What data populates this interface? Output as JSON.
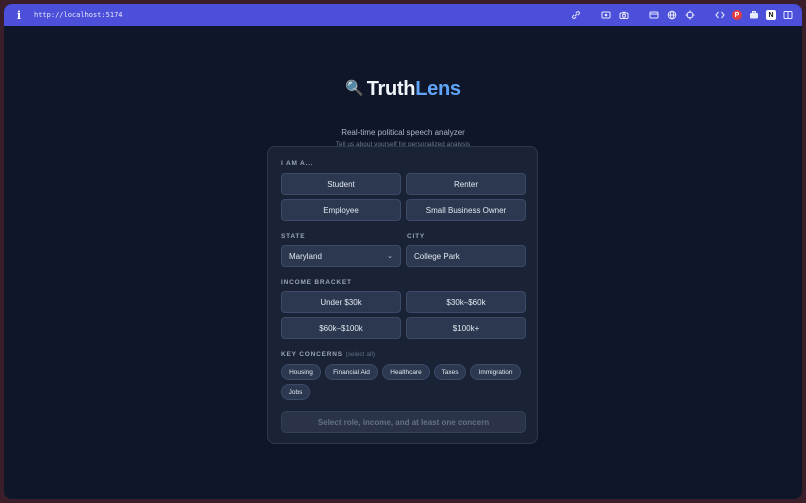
{
  "browser": {
    "url": "http://localhost:5174"
  },
  "app": {
    "brand_part1": "Truth",
    "brand_part2": "Lens",
    "brand_icon": "🔍",
    "tagline": "Real-time political speech analyzer",
    "subtagline": "Tell us about yourself for personalized analysis"
  },
  "form": {
    "role_label": "I AM A...",
    "roles": [
      "Student",
      "Renter",
      "Employee",
      "Small Business Owner"
    ],
    "state_label": "STATE",
    "state_value": "Maryland",
    "city_label": "CITY",
    "city_value": "College Park",
    "income_label": "INCOME BRACKET",
    "incomes": [
      "Under $30k",
      "$30k–$60k",
      "$60k–$100k",
      "$100k+"
    ],
    "concerns_label": "KEY CONCERNS",
    "concerns_hint": "(select all)",
    "concerns": [
      "Housing",
      "Financial Aid",
      "Healthcare",
      "Taxes",
      "Immigration",
      "Jobs"
    ],
    "submit_label": "Select role, income, and at least one concern"
  },
  "colors": {
    "accent": "#60a5fa",
    "toolbar": "#4b4fd9",
    "background": "#0f1629"
  }
}
